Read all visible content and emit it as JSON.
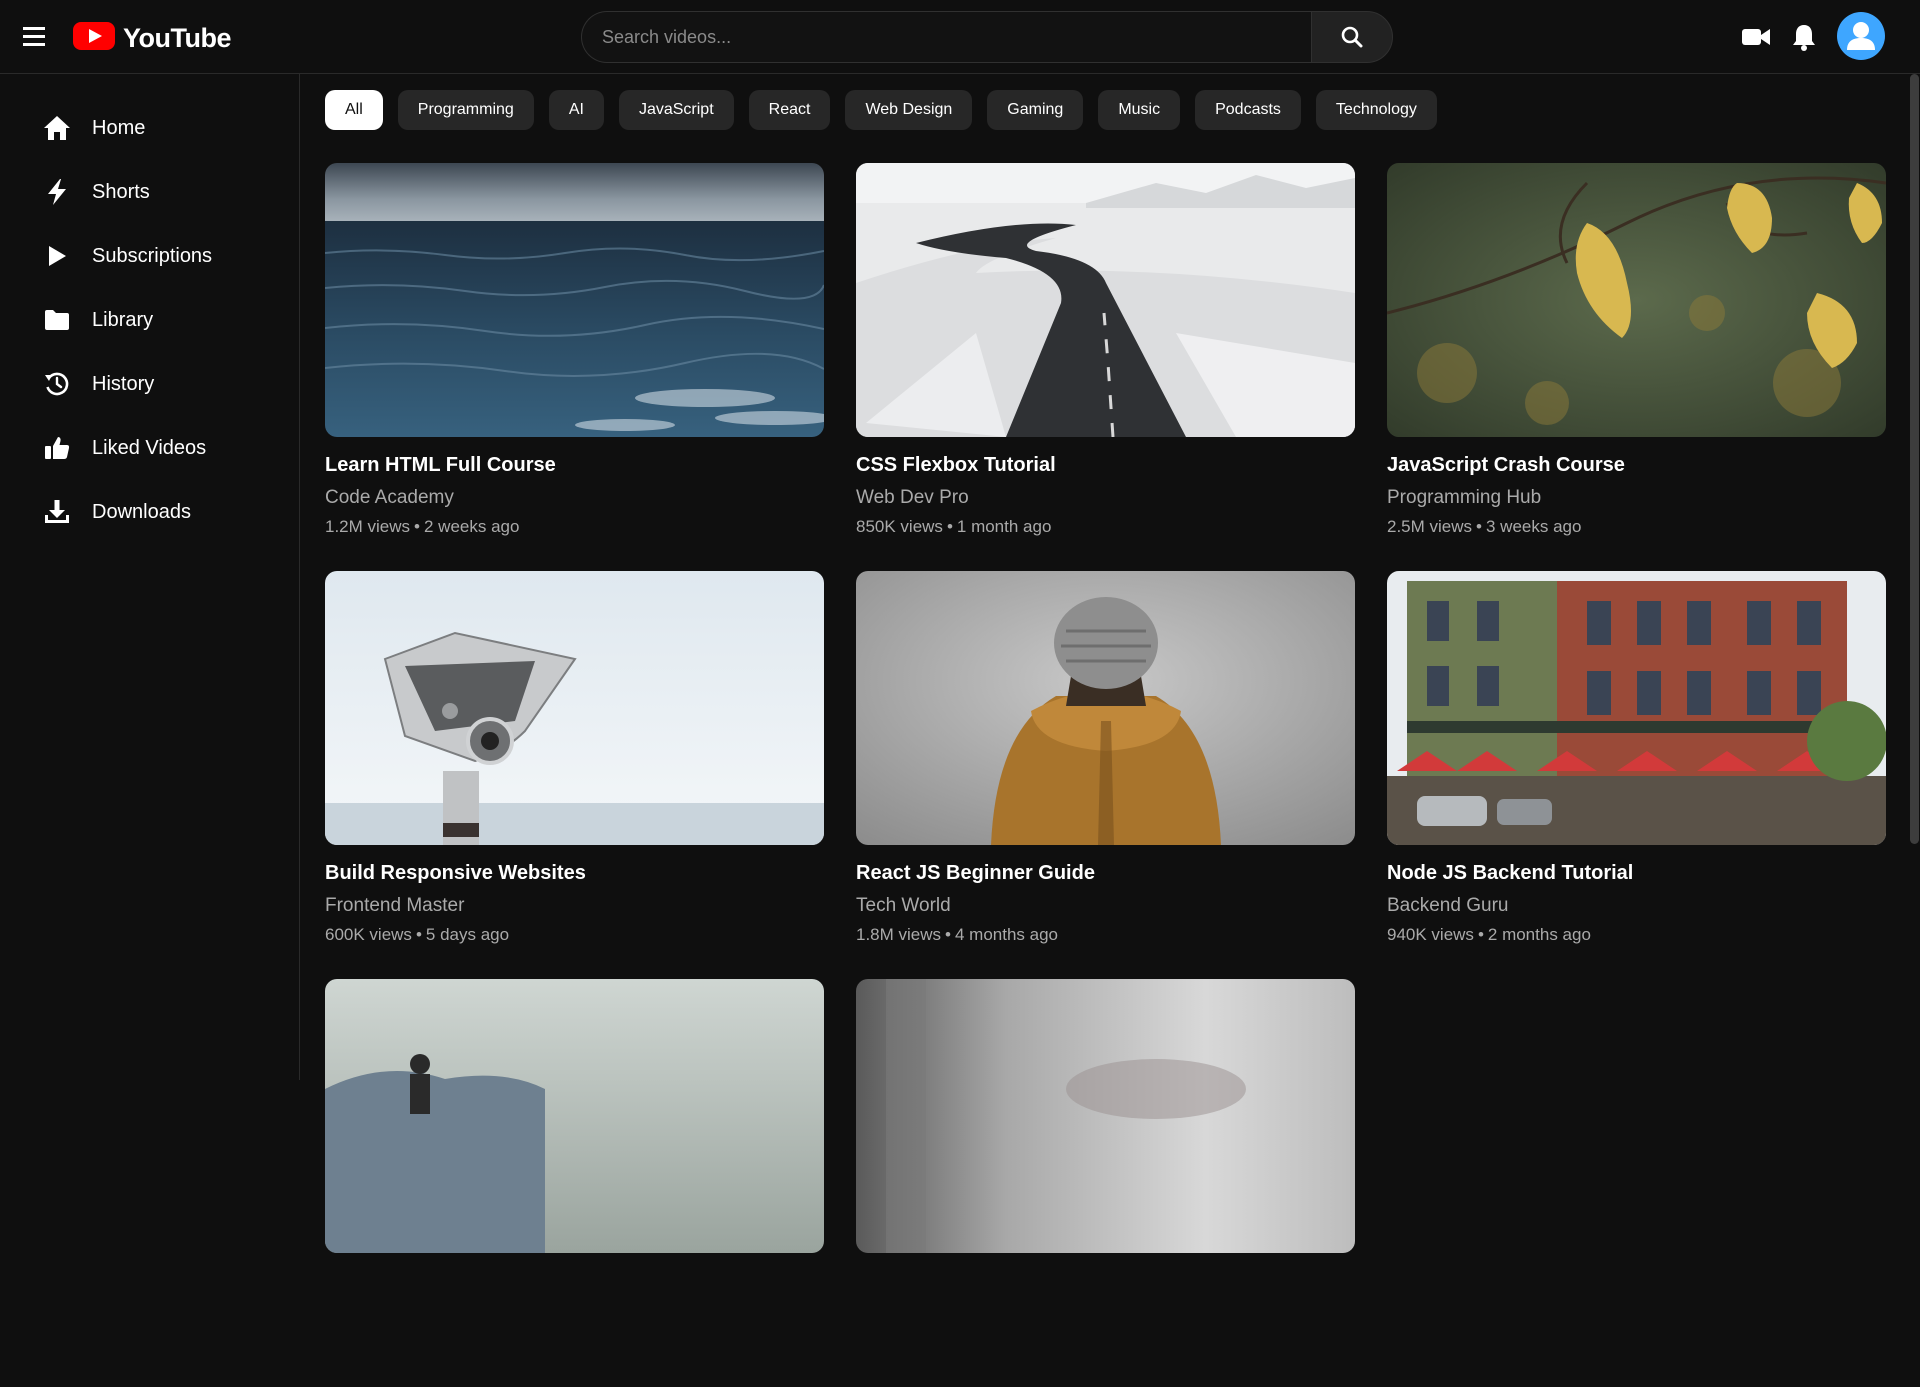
{
  "header": {
    "logo_text": "YouTube",
    "search_placeholder": "Search videos...",
    "brand_color": "#ff0000",
    "avatar_color": "#3ea6ff"
  },
  "sidebar": {
    "items": [
      {
        "label": "Home",
        "icon": "home-icon"
      },
      {
        "label": "Shorts",
        "icon": "bolt-icon"
      },
      {
        "label": "Subscriptions",
        "icon": "play-icon"
      },
      {
        "label": "Library",
        "icon": "folder-icon"
      },
      {
        "label": "History",
        "icon": "history-icon"
      },
      {
        "label": "Liked Videos",
        "icon": "thumbs-up-icon"
      },
      {
        "label": "Downloads",
        "icon": "download-icon"
      }
    ]
  },
  "chips": [
    {
      "label": "All",
      "active": true
    },
    {
      "label": "Programming"
    },
    {
      "label": "AI"
    },
    {
      "label": "JavaScript"
    },
    {
      "label": "React"
    },
    {
      "label": "Web Design"
    },
    {
      "label": "Gaming"
    },
    {
      "label": "Music"
    },
    {
      "label": "Podcasts"
    },
    {
      "label": "Technology"
    }
  ],
  "videos": [
    {
      "title": "Learn HTML Full Course",
      "channel": "Code Academy",
      "views": "1.2M views",
      "age": "2 weeks ago",
      "thumb": "ocean-waves"
    },
    {
      "title": "CSS Flexbox Tutorial",
      "channel": "Web Dev Pro",
      "views": "850K views",
      "age": "1 month ago",
      "thumb": "snowy-road"
    },
    {
      "title": "JavaScript Crash Course",
      "channel": "Programming Hub",
      "views": "2.5M views",
      "age": "3 weeks ago",
      "thumb": "autumn-leaves"
    },
    {
      "title": "Build Responsive Websites",
      "channel": "Frontend Master",
      "views": "600K views",
      "age": "5 days ago",
      "thumb": "tower-viewer"
    },
    {
      "title": "React JS Beginner Guide",
      "channel": "Tech World",
      "views": "1.8M views",
      "age": "4 months ago",
      "thumb": "person-beanie"
    },
    {
      "title": "Node JS Backend Tutorial",
      "channel": "Backend Guru",
      "views": "940K views",
      "age": "2 months ago",
      "thumb": "brick-building"
    },
    {
      "title": "",
      "channel": "",
      "views": "",
      "age": "",
      "thumb": "mountain-hiker"
    },
    {
      "title": "",
      "channel": "",
      "views": "",
      "age": "",
      "thumb": "blurred-room"
    }
  ]
}
